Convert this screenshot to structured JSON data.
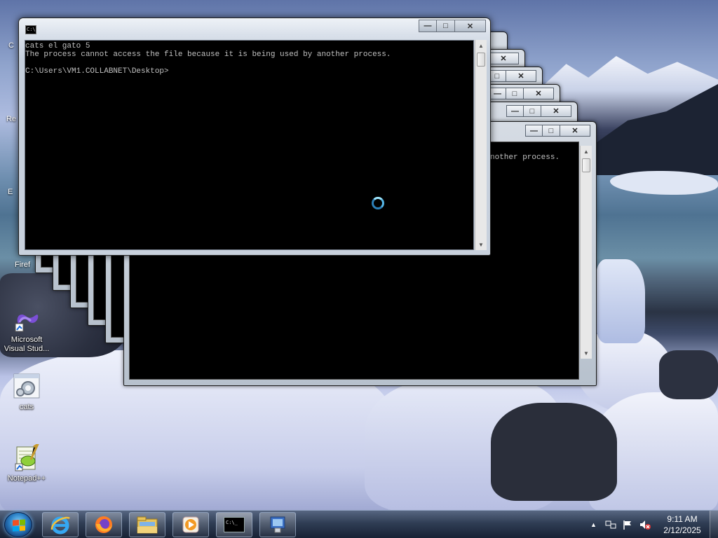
{
  "desktop": {
    "icons": [
      {
        "label": "Microsoft Visual Stud..."
      },
      {
        "label": "cats"
      },
      {
        "label": "Notepad++"
      }
    ],
    "cut_labels": [
      "C",
      "Re",
      "E",
      "Firef"
    ]
  },
  "console": {
    "lines": [
      "cats el gato 5",
      "The process cannot access the file because it is being used by another process.",
      "",
      "C:\\Users\\VM1.COLLABNET\\Desktop>"
    ],
    "background_window_text": "nother process."
  },
  "taskbar": {
    "apps": [
      {
        "name": "internet-explorer-icon"
      },
      {
        "name": "firefox-icon"
      },
      {
        "name": "file-explorer-icon"
      },
      {
        "name": "media-player-icon"
      },
      {
        "name": "command-prompt-icon"
      },
      {
        "name": "program-icon"
      }
    ],
    "clock": {
      "time": "9:11 AM",
      "date": "2/12/2025"
    }
  },
  "colors": {
    "console_bg": "#000000",
    "console_fg": "#c0c0c0",
    "spinner": "#5cc8f0"
  }
}
